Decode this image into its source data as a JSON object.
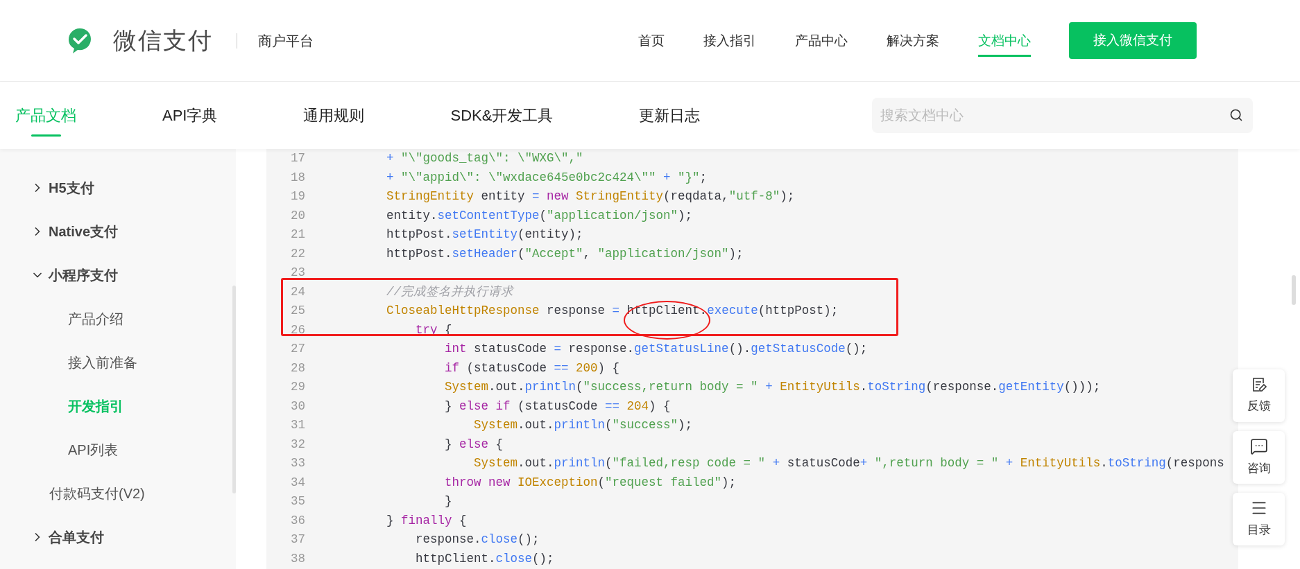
{
  "header": {
    "brand": "微信支付",
    "subtitle": "商户平台",
    "nav": [
      {
        "label": "首页",
        "selected": false
      },
      {
        "label": "接入指引",
        "selected": false
      },
      {
        "label": "产品中心",
        "selected": false
      },
      {
        "label": "解决方案",
        "selected": false
      },
      {
        "label": "文档中心",
        "selected": true
      }
    ],
    "cta": "接入微信支付"
  },
  "doc_tabs": [
    {
      "label": "产品文档",
      "selected": true
    },
    {
      "label": "API字典",
      "selected": false
    },
    {
      "label": "通用规则",
      "selected": false
    },
    {
      "label": "SDK&开发工具",
      "selected": false
    },
    {
      "label": "更新日志",
      "selected": false
    }
  ],
  "search": {
    "placeholder": "搜索文档中心"
  },
  "sidebar": {
    "items": [
      {
        "label": "H5支付",
        "kind": "group",
        "expanded": false
      },
      {
        "label": "Native支付",
        "kind": "group",
        "expanded": false
      },
      {
        "label": "小程序支付",
        "kind": "group",
        "expanded": true,
        "children": [
          {
            "label": "产品介绍",
            "selected": false
          },
          {
            "label": "接入前准备",
            "selected": false
          },
          {
            "label": "开发指引",
            "selected": true
          },
          {
            "label": "API列表",
            "selected": false
          }
        ]
      },
      {
        "label": "付款码支付(V2)",
        "kind": "page",
        "selected": false
      },
      {
        "label": "合单支付",
        "kind": "group",
        "expanded": false
      }
    ]
  },
  "code": {
    "lines": [
      {
        "number": "17",
        "tokens": [
          {
            "text": "+ ",
            "kind": "op"
          },
          {
            "text": "\"\\\"goods_tag\\\": \\\"WXG\\\",\"",
            "kind": "string"
          }
        ]
      },
      {
        "number": "18",
        "tokens": [
          {
            "text": "+ ",
            "kind": "op"
          },
          {
            "text": "\"\\\"appid\\\": \\\"wxdace645e0bc2c424\\\"\"",
            "kind": "string"
          },
          {
            "text": " + ",
            "kind": "op"
          },
          {
            "text": "\"}\"",
            "kind": "string"
          },
          {
            "text": ";",
            "kind": "plain"
          }
        ]
      },
      {
        "number": "19",
        "tokens": [
          {
            "text": "StringEntity",
            "kind": "type"
          },
          {
            "text": " entity ",
            "kind": "plain"
          },
          {
            "text": "= ",
            "kind": "op"
          },
          {
            "text": "new ",
            "kind": "keyword"
          },
          {
            "text": "StringEntity",
            "kind": "type"
          },
          {
            "text": "(reqdata,",
            "kind": "plain"
          },
          {
            "text": "\"utf-8\"",
            "kind": "string"
          },
          {
            "text": ");",
            "kind": "plain"
          }
        ]
      },
      {
        "number": "20",
        "tokens": [
          {
            "text": "entity.",
            "kind": "plain"
          },
          {
            "text": "setContentType",
            "kind": "method"
          },
          {
            "text": "(",
            "kind": "plain"
          },
          {
            "text": "\"application/json\"",
            "kind": "string"
          },
          {
            "text": ");",
            "kind": "plain"
          }
        ]
      },
      {
        "number": "21",
        "tokens": [
          {
            "text": "httpPost.",
            "kind": "plain"
          },
          {
            "text": "setEntity",
            "kind": "method"
          },
          {
            "text": "(entity);",
            "kind": "plain"
          }
        ]
      },
      {
        "number": "22",
        "tokens": [
          {
            "text": "httpPost.",
            "kind": "plain"
          },
          {
            "text": "setHeader",
            "kind": "method"
          },
          {
            "text": "(",
            "kind": "plain"
          },
          {
            "text": "\"Accept\"",
            "kind": "string"
          },
          {
            "text": ", ",
            "kind": "plain"
          },
          {
            "text": "\"application/json\"",
            "kind": "string"
          },
          {
            "text": ");",
            "kind": "plain"
          }
        ]
      },
      {
        "number": "23"
      },
      {
        "number": "24",
        "tokens": [
          {
            "text": "//完成签名并执行请求",
            "kind": "comment"
          }
        ]
      },
      {
        "number": "25",
        "tokens": [
          {
            "text": "CloseableHttpResponse",
            "kind": "type"
          },
          {
            "text": " response ",
            "kind": "plain"
          },
          {
            "text": "= ",
            "kind": "op"
          },
          {
            "text": "httpClient.",
            "kind": "plain"
          },
          {
            "text": "execute",
            "kind": "method"
          },
          {
            "text": "(httpPost);",
            "kind": "plain"
          }
        ]
      },
      {
        "number": "26",
        "tokens": [
          {
            "text": "    try",
            "kind": "keyword"
          },
          {
            "text": " {",
            "kind": "plain"
          }
        ]
      },
      {
        "number": "27",
        "tokens": [
          {
            "text": "        int",
            "kind": "keyword"
          },
          {
            "text": " statusCode ",
            "kind": "plain"
          },
          {
            "text": "= ",
            "kind": "op"
          },
          {
            "text": "response.",
            "kind": "plain"
          },
          {
            "text": "getStatusLine",
            "kind": "method"
          },
          {
            "text": "().",
            "kind": "plain"
          },
          {
            "text": "getStatusCode",
            "kind": "method"
          },
          {
            "text": "();",
            "kind": "plain"
          }
        ]
      },
      {
        "number": "28",
        "tokens": [
          {
            "text": "        if",
            "kind": "keyword"
          },
          {
            "text": " (statusCode ",
            "kind": "plain"
          },
          {
            "text": "== ",
            "kind": "op"
          },
          {
            "text": "200",
            "kind": "number"
          },
          {
            "text": ") {",
            "kind": "plain"
          }
        ]
      },
      {
        "number": "29",
        "tokens": [
          {
            "text": "        System",
            "kind": "type"
          },
          {
            "text": ".out.",
            "kind": "plain"
          },
          {
            "text": "println",
            "kind": "method"
          },
          {
            "text": "(",
            "kind": "plain"
          },
          {
            "text": "\"success,return body = \"",
            "kind": "string"
          },
          {
            "text": " + ",
            "kind": "op"
          },
          {
            "text": "EntityUtils",
            "kind": "type"
          },
          {
            "text": ".",
            "kind": "plain"
          },
          {
            "text": "toString",
            "kind": "method"
          },
          {
            "text": "(response.",
            "kind": "plain"
          },
          {
            "text": "getEntity",
            "kind": "method"
          },
          {
            "text": "()));",
            "kind": "plain"
          }
        ]
      },
      {
        "number": "30",
        "tokens": [
          {
            "text": "        } ",
            "kind": "plain"
          },
          {
            "text": "else if",
            "kind": "keyword"
          },
          {
            "text": " (statusCode ",
            "kind": "plain"
          },
          {
            "text": "== ",
            "kind": "op"
          },
          {
            "text": "204",
            "kind": "number"
          },
          {
            "text": ") {",
            "kind": "plain"
          }
        ]
      },
      {
        "number": "31",
        "tokens": [
          {
            "text": "            System",
            "kind": "type"
          },
          {
            "text": ".out.",
            "kind": "plain"
          },
          {
            "text": "println",
            "kind": "method"
          },
          {
            "text": "(",
            "kind": "plain"
          },
          {
            "text": "\"success\"",
            "kind": "string"
          },
          {
            "text": ");",
            "kind": "plain"
          }
        ]
      },
      {
        "number": "32",
        "tokens": [
          {
            "text": "        } ",
            "kind": "plain"
          },
          {
            "text": "else",
            "kind": "keyword"
          },
          {
            "text": " {",
            "kind": "plain"
          }
        ]
      },
      {
        "number": "33",
        "tokens": [
          {
            "text": "            System",
            "kind": "type"
          },
          {
            "text": ".out.",
            "kind": "plain"
          },
          {
            "text": "println",
            "kind": "method"
          },
          {
            "text": "(",
            "kind": "plain"
          },
          {
            "text": "\"failed,resp code = \"",
            "kind": "string"
          },
          {
            "text": " + ",
            "kind": "op"
          },
          {
            "text": "statusCode",
            "kind": "plain"
          },
          {
            "text": "+ ",
            "kind": "op"
          },
          {
            "text": "\",return body = \"",
            "kind": "string"
          },
          {
            "text": " + ",
            "kind": "op"
          },
          {
            "text": "EntityUtils",
            "kind": "type"
          },
          {
            "text": ".",
            "kind": "plain"
          },
          {
            "text": "toString",
            "kind": "method"
          },
          {
            "text": "(respons",
            "kind": "plain"
          }
        ]
      },
      {
        "number": "34",
        "tokens": [
          {
            "text": "        throw new ",
            "kind": "keyword"
          },
          {
            "text": "IOException",
            "kind": "type"
          },
          {
            "text": "(",
            "kind": "plain"
          },
          {
            "text": "\"request failed\"",
            "kind": "string"
          },
          {
            "text": ");",
            "kind": "plain"
          }
        ]
      },
      {
        "number": "35",
        "tokens": [
          {
            "text": "        }",
            "kind": "plain"
          }
        ]
      },
      {
        "number": "36",
        "tokens": [
          {
            "text": "} ",
            "kind": "plain"
          },
          {
            "text": "finally",
            "kind": "keyword"
          },
          {
            "text": " {",
            "kind": "plain"
          }
        ]
      },
      {
        "number": "37",
        "tokens": [
          {
            "text": "    response.",
            "kind": "plain"
          },
          {
            "text": "close",
            "kind": "method"
          },
          {
            "text": "();",
            "kind": "plain"
          }
        ]
      },
      {
        "number": "38",
        "tokens": [
          {
            "text": "    httpClient.",
            "kind": "plain"
          },
          {
            "text": "close",
            "kind": "method"
          },
          {
            "text": "();",
            "kind": "plain"
          }
        ]
      }
    ]
  },
  "float_buttons": [
    {
      "label": "反馈",
      "kind": "feedback"
    },
    {
      "label": "咨询",
      "kind": "consult"
    },
    {
      "label": "目录",
      "kind": "toc"
    }
  ]
}
